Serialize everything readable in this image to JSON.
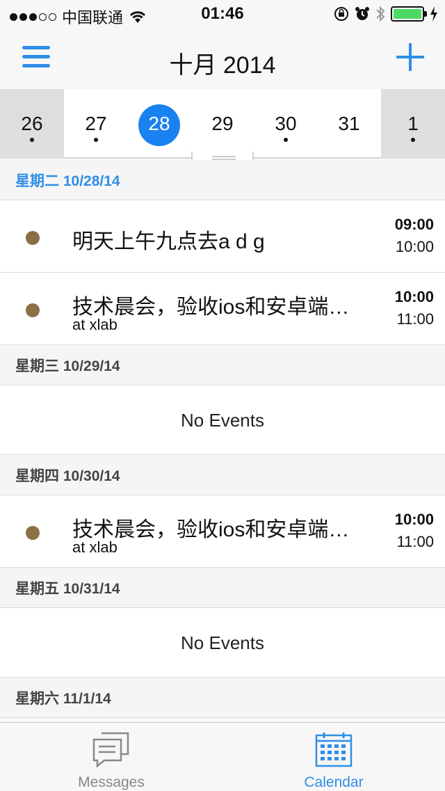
{
  "status": {
    "carrier": "中国联通",
    "time": "01:46"
  },
  "nav": {
    "title": "十月 2014"
  },
  "week": [
    {
      "num": "26",
      "state": "dim",
      "dot": true
    },
    {
      "num": "27",
      "state": "normal",
      "dot": true
    },
    {
      "num": "28",
      "state": "selected",
      "dot": false
    },
    {
      "num": "29",
      "state": "normal",
      "dot": false
    },
    {
      "num": "30",
      "state": "normal",
      "dot": true
    },
    {
      "num": "31",
      "state": "normal",
      "dot": false
    },
    {
      "num": "1",
      "state": "dim",
      "dot": true
    }
  ],
  "days": [
    {
      "header": "星期二 10/28/14",
      "today": true,
      "events": [
        {
          "title": "明天上午九点去a d g",
          "location": "",
          "start": "09:00",
          "end": "10:00"
        },
        {
          "title": "技术晨会，验收ios和安卓端…",
          "location": "at xlab",
          "start": "10:00",
          "end": "11:00"
        }
      ]
    },
    {
      "header": "星期三 10/29/14",
      "today": false,
      "events": [],
      "empty": "No Events"
    },
    {
      "header": "星期四 10/30/14",
      "today": false,
      "events": [
        {
          "title": "技术晨会，验收ios和安卓端…",
          "location": "at xlab",
          "start": "10:00",
          "end": "11:00"
        }
      ]
    },
    {
      "header": "星期五 10/31/14",
      "today": false,
      "events": [],
      "empty": "No Events"
    },
    {
      "header": "星期六 11/1/14",
      "today": false,
      "events": []
    }
  ],
  "tabs": {
    "messages": "Messages",
    "calendar": "Calendar"
  },
  "colors": {
    "accent": "#2f8ee8",
    "selected_day": "#1a82f0",
    "event_bullet": "#8b6f45",
    "battery": "#4cd964"
  }
}
